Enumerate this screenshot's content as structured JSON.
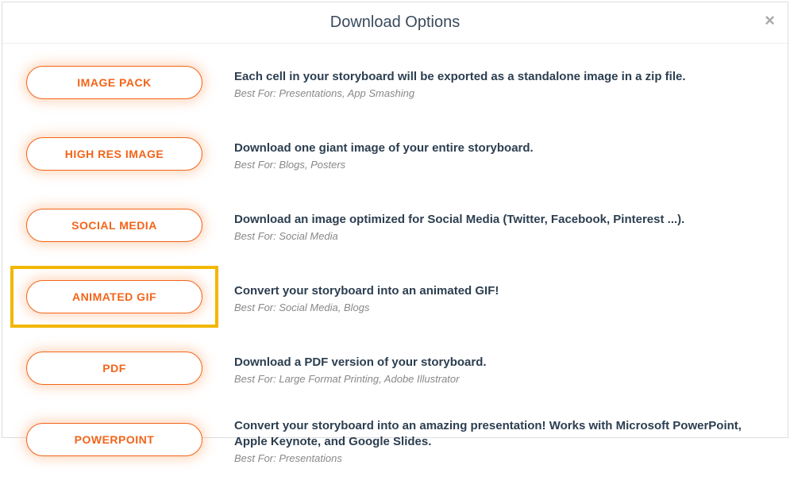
{
  "modal": {
    "title": "Download Options"
  },
  "options": [
    {
      "label": "IMAGE PACK",
      "description": "Each cell in your storyboard will be exported as a standalone image in a zip file.",
      "bestFor": "Best For: Presentations, App Smashing",
      "highlighted": false
    },
    {
      "label": "HIGH RES IMAGE",
      "description": "Download one giant image of your entire storyboard.",
      "bestFor": "Best For: Blogs, Posters",
      "highlighted": false
    },
    {
      "label": "SOCIAL MEDIA",
      "description": "Download an image optimized for Social Media (Twitter, Facebook, Pinterest ...).",
      "bestFor": "Best For: Social Media",
      "highlighted": false
    },
    {
      "label": "ANIMATED GIF",
      "description": "Convert your storyboard into an animated GIF!",
      "bestFor": "Best For: Social Media, Blogs",
      "highlighted": true
    },
    {
      "label": "PDF",
      "description": "Download a PDF version of your storyboard.",
      "bestFor": "Best For: Large Format Printing, Adobe Illustrator",
      "highlighted": false
    },
    {
      "label": "POWERPOINT",
      "description": "Convert your storyboard into an amazing presentation! Works with Microsoft PowerPoint, Apple Keynote, and Google Slides.",
      "bestFor": "Best For: Presentations",
      "highlighted": false
    }
  ]
}
